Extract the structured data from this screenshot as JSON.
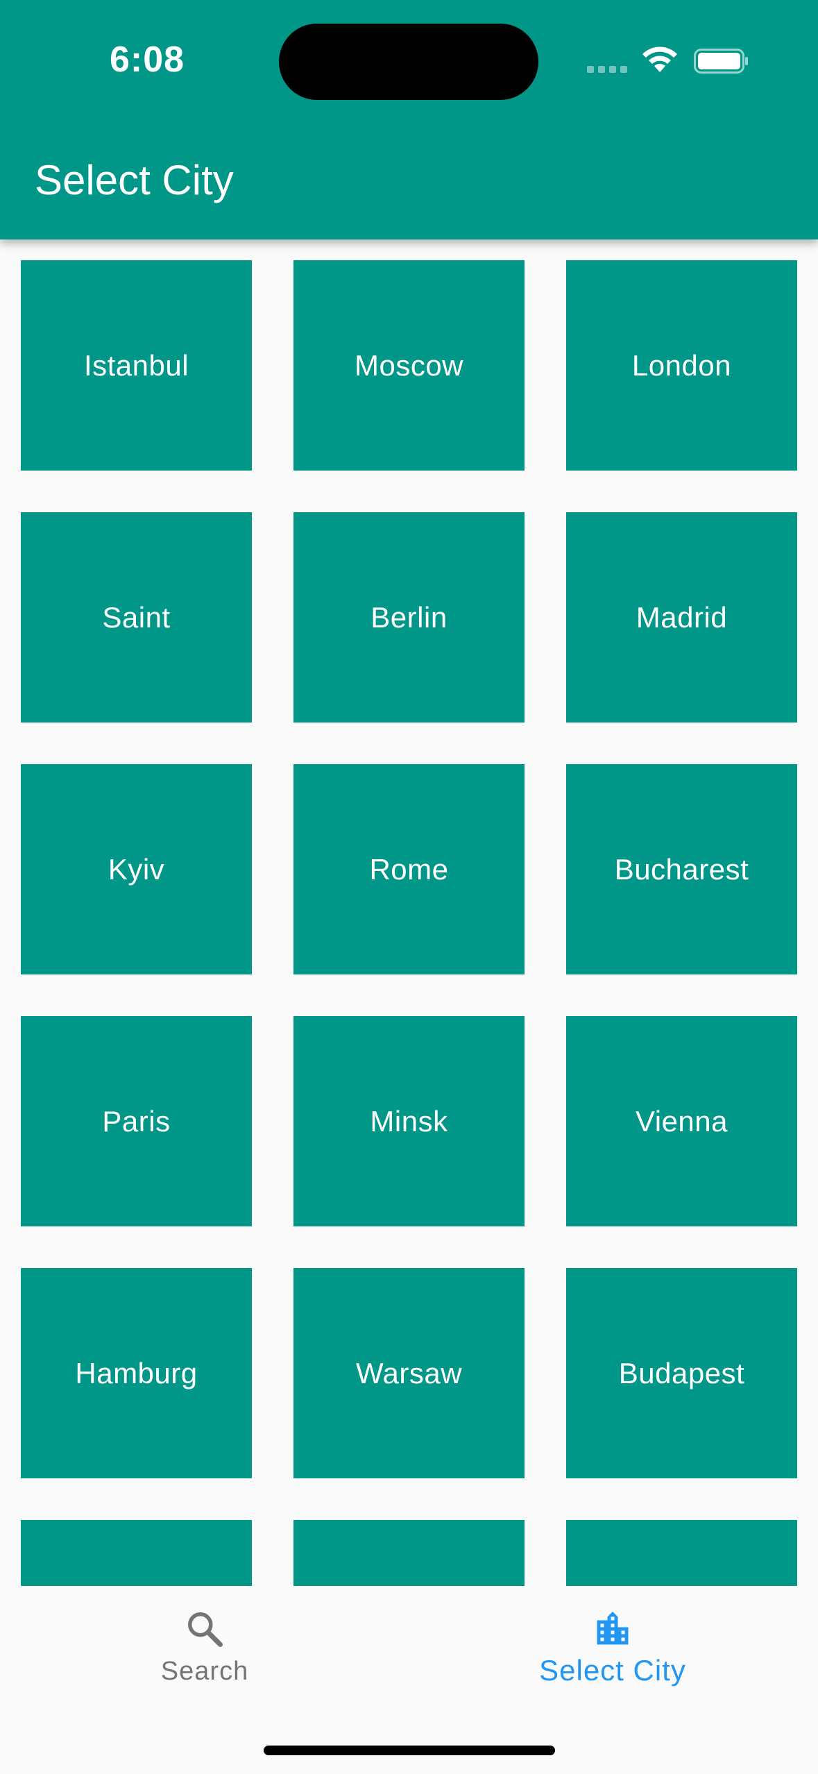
{
  "status_bar": {
    "time": "6:08",
    "icons": [
      "signal-icon",
      "wifi-icon",
      "battery-icon"
    ]
  },
  "app_bar": {
    "title": "Select City",
    "color": "#009688"
  },
  "cities": [
    "Istanbul",
    "Moscow",
    "London",
    "Saint",
    "Berlin",
    "Madrid",
    "Kyiv",
    "Rome",
    "Bucharest",
    "Paris",
    "Minsk",
    "Vienna",
    "Hamburg",
    "Warsaw",
    "Budapest",
    "",
    "",
    ""
  ],
  "bottom_nav": {
    "items": [
      {
        "label": "Search",
        "icon": "search-icon",
        "selected": false
      },
      {
        "label": "Select City",
        "icon": "location-city-icon",
        "selected": true
      }
    ],
    "active_color": "#2196f3",
    "inactive_color": "#757575"
  }
}
